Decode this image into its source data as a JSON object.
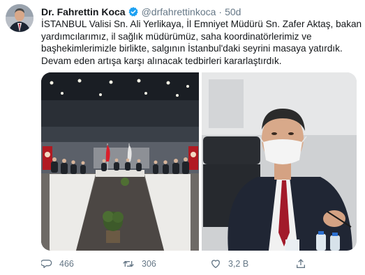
{
  "tweet": {
    "author_name": "Dr. Fahrettin Koca",
    "handle": "@drfahrettinkoca",
    "separator": "·",
    "time": "50d",
    "text_lines": [
      "İSTANBUL Valisi Sn. Ali Yerlikaya, İl Emniyet Müdürü Sn. Zafer Aktaş, bakan",
      "yardımcılarımız, il sağlık müdürümüz, saha koordinatörlerimiz ve",
      "başhekimlerimizle birlikte, salgının İstanbul'daki seyrini masaya yatırdık.",
      "Devam eden artışa karşı alınacak tedbirleri kararlaştırdık."
    ]
  },
  "actions": {
    "reply_count": "466",
    "retweet_count": "306",
    "like_count": "3,2 B"
  },
  "icons": {
    "verified": "verified-badge-icon",
    "reply": "reply-icon",
    "retweet": "retweet-icon",
    "like": "heart-icon",
    "share": "share-icon"
  },
  "colors": {
    "verified": "#1da1f2",
    "secondary_text": "#657786",
    "flag_red": "#d9202c"
  }
}
